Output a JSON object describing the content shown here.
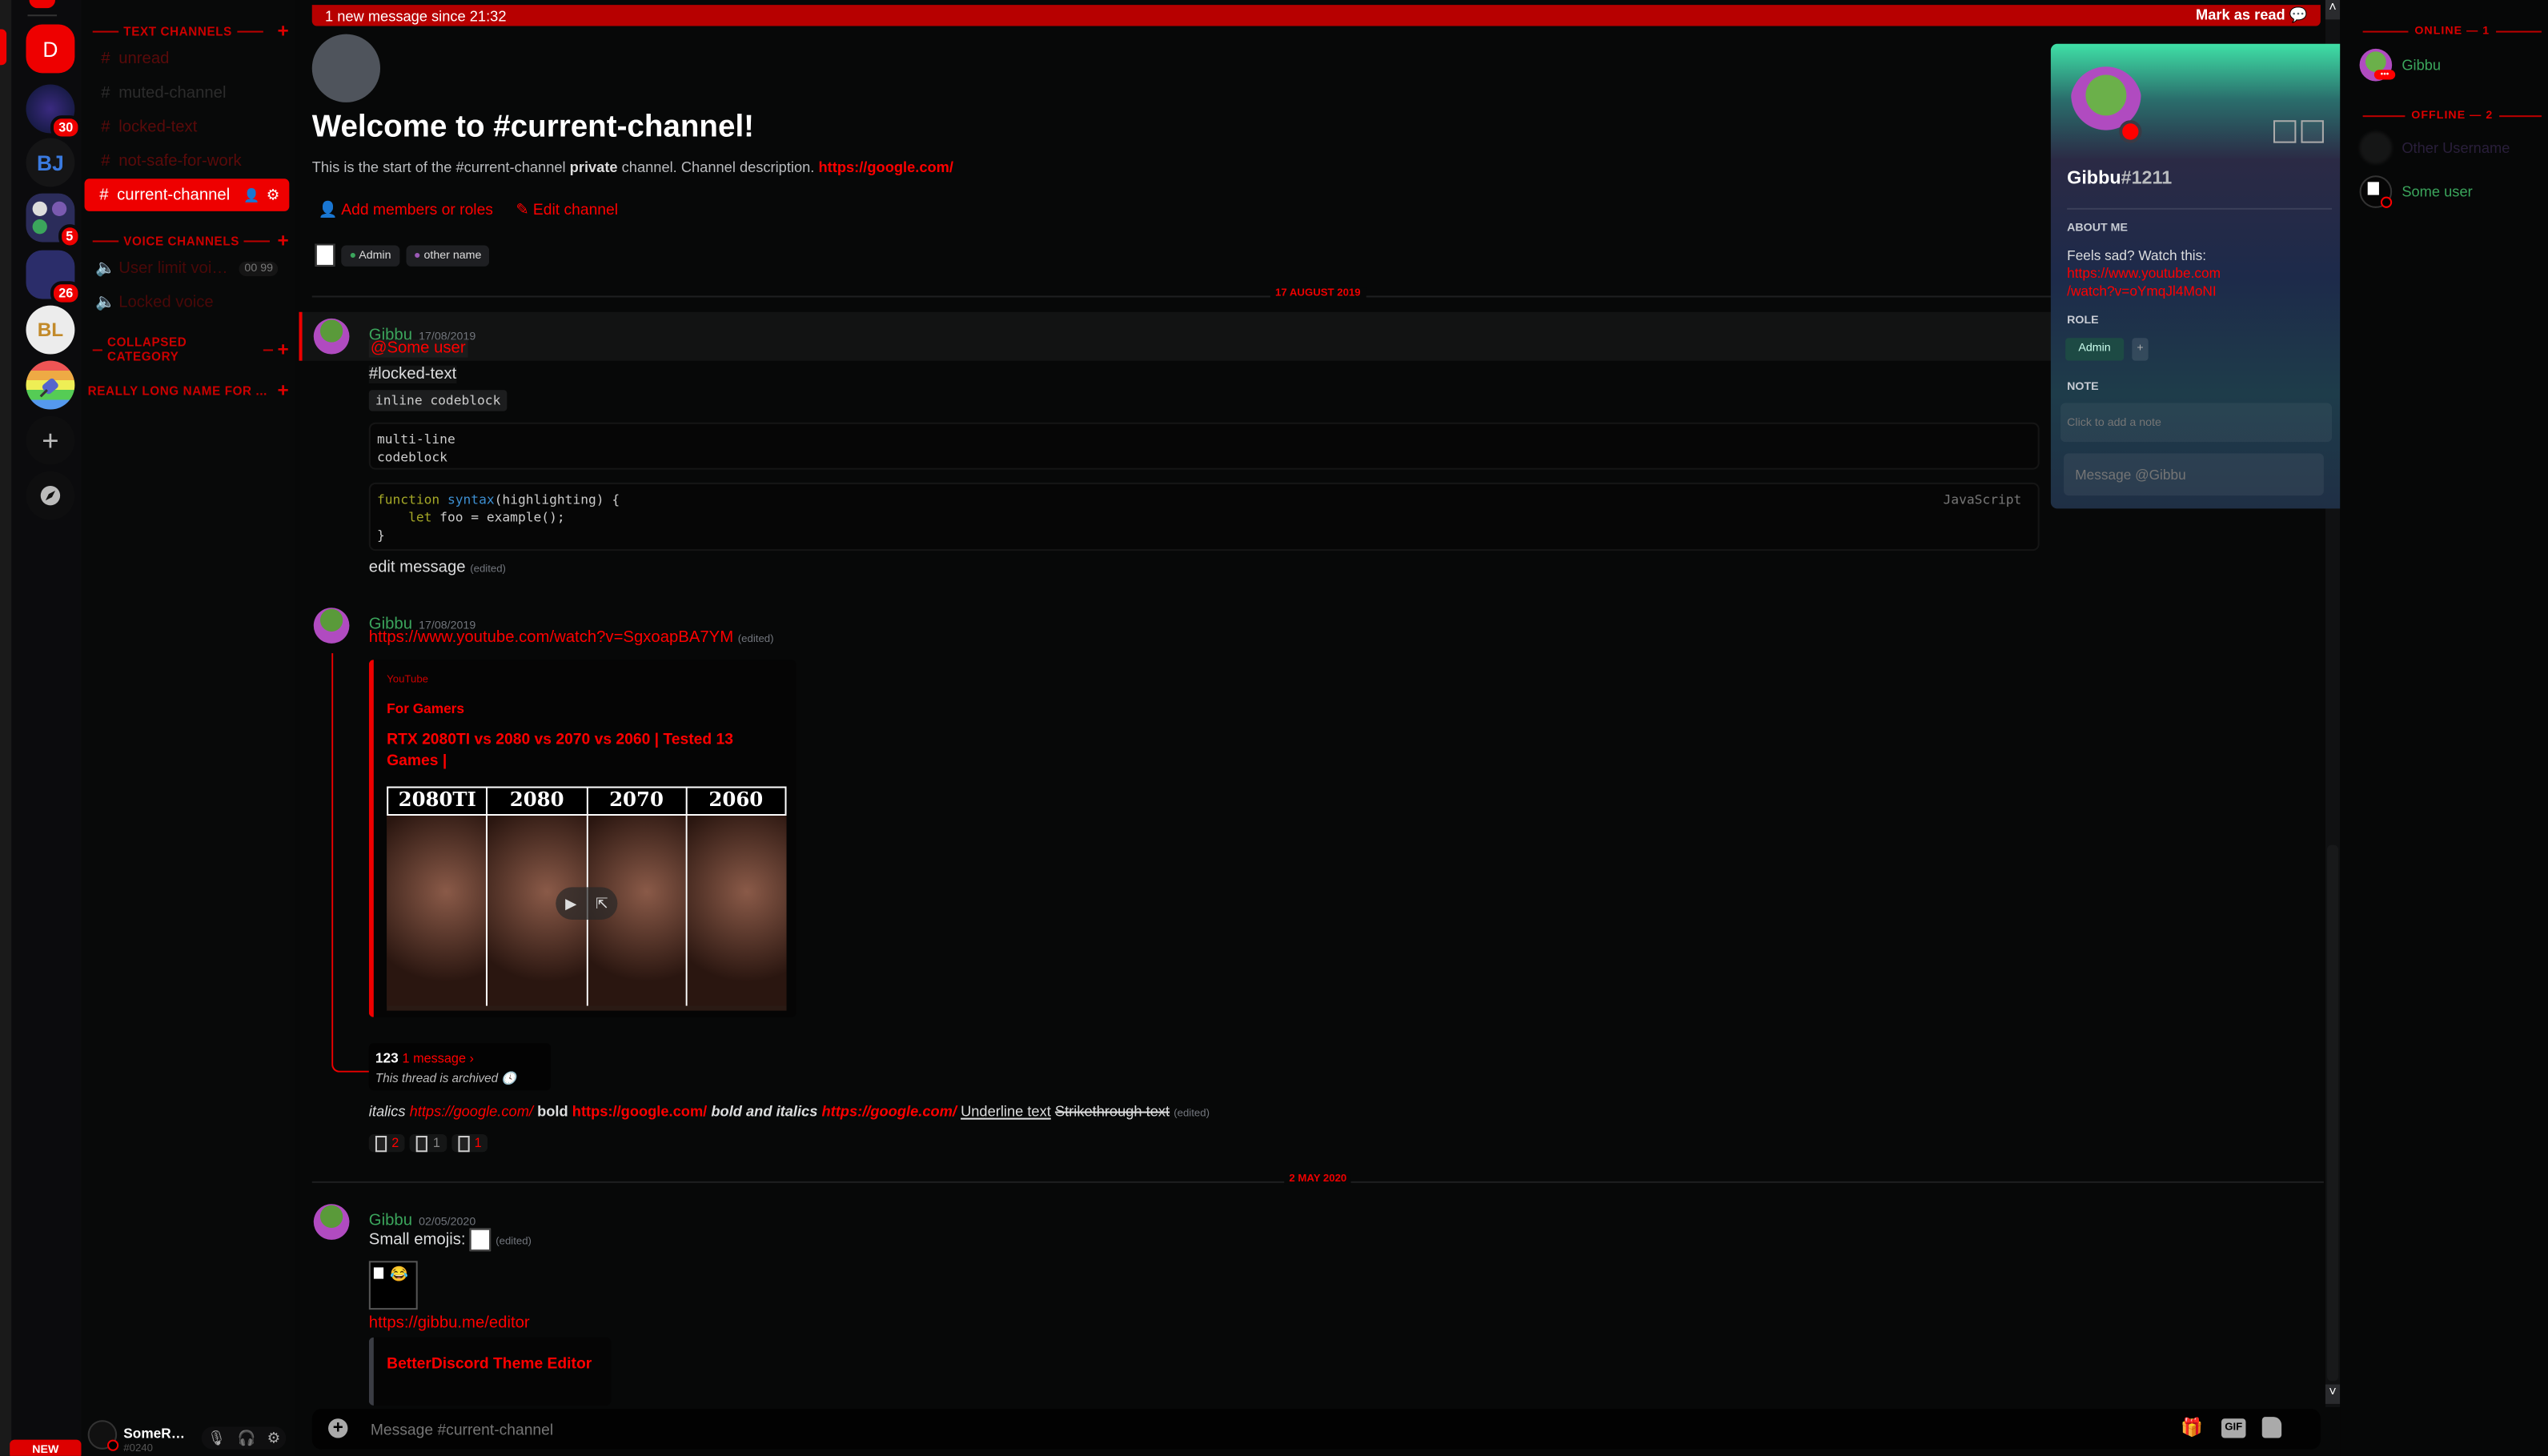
{
  "server_rail": {
    "servers": [
      {
        "name": "D",
        "badge": "",
        "color": "#e00000"
      },
      {
        "name": "Rocket League",
        "badge": "30"
      },
      {
        "name": "BJ",
        "badge": ""
      },
      {
        "name": "Folder",
        "badge": "5"
      },
      {
        "name": "Blank",
        "badge": "26"
      },
      {
        "name": "BL",
        "badge": ""
      },
      {
        "name": "Plug",
        "badge": ""
      }
    ],
    "add_server_icon": "plus-icon",
    "explore_icon": "compass-icon"
  },
  "channels": {
    "categories": [
      {
        "label": "TEXT CHANNELS"
      },
      {
        "label": "VOICE CHANNELS"
      },
      {
        "label": "COLLAPSED CATEGORY"
      },
      {
        "label": "REALLY LONG NAME FOR ..."
      }
    ],
    "text": [
      {
        "label": "unread",
        "state": "locked"
      },
      {
        "label": "muted-channel",
        "state": "muted"
      },
      {
        "label": "locked-text",
        "state": "locked"
      },
      {
        "label": "not-safe-for-work",
        "state": "nsfw"
      },
      {
        "label": "current-channel",
        "state": "active"
      }
    ],
    "voice": [
      {
        "label": "User limit voi…",
        "count": "00",
        "limit": "99"
      },
      {
        "label": "Locked voice"
      }
    ]
  },
  "user_panel": {
    "username": "SomeR…",
    "discriminator": "#0240",
    "new_badge": "NEW"
  },
  "main": {
    "new_messages_bar": "1 new message since 21:32",
    "mark_as_read": "Mark as read",
    "welcome_title": "Welcome to #current-channel!",
    "welcome_desc_pre": "This is the start of the #current-channel ",
    "welcome_desc_bold": "private",
    "welcome_desc_post": " channel. Channel description. ",
    "welcome_link": "https://google.com/",
    "add_members": "Add members or roles",
    "edit_channel": "Edit channel",
    "roles": [
      {
        "label": "Admin",
        "color": "#3ba55c"
      },
      {
        "label": "other name",
        "color": "#9b59b6"
      }
    ],
    "date_dividers": [
      "17 AUGUST 2019",
      "2 MAY 2020"
    ],
    "messages": [
      {
        "author": "Gibbu",
        "timestamp": "17/08/2019",
        "mention": "@Some user",
        "channel_mention": "#locked-text",
        "inline_code": "inline codeblock",
        "multiline_code": [
          "multi-line",
          "codeblock"
        ],
        "code_kw": "function",
        "code_fn": "syntax",
        "code_rest": "(highlighting) {",
        "code_l2_kw": "let",
        "code_l2_rest": " foo = example();",
        "code_l3": "}",
        "code_lang": "JavaScript",
        "edit_text": "edit message",
        "edited": "(edited)"
      },
      {
        "author": "Gibbu",
        "timestamp": "17/08/2019",
        "link": "https://www.youtube.com/watch?v=SgxoapBA7YM",
        "edited": "(edited)",
        "embed_provider": "YouTube",
        "embed_author": "For Gamers",
        "embed_title": "RTX 2080TI vs 2080 vs 2070 vs 2060 | Tested 13 Games |",
        "thumb_labels": [
          "2080TI",
          "2080",
          "2070",
          "2060"
        ],
        "thread_name": "123",
        "thread_count": "1 message ›",
        "thread_status": "This thread is archived",
        "fmt_italics": "italics",
        "fmt_link": "https://google.com/",
        "fmt_bold": "bold",
        "fmt_bold_italics": "bold and italics",
        "fmt_underline": "Underline text",
        "fmt_strike": "Strikethrough text",
        "reactions": [
          {
            "count": "2",
            "active": true
          },
          {
            "count": "1",
            "active": false
          },
          {
            "count": "1",
            "active": true
          }
        ]
      },
      {
        "author": "Gibbu",
        "timestamp": "02/05/2020",
        "text": "Small emojis:",
        "edited": "(edited)",
        "link": "https://gibbu.me/editor",
        "embed_title": "BetterDiscord Theme Editor"
      }
    ],
    "composer_placeholder": "Message #current-channel"
  },
  "popout": {
    "username": "Gibbu",
    "discriminator": "#1211",
    "about_label": "ABOUT ME",
    "about_text": "Feels sad? Watch this:",
    "about_link1": "https://www.youtube.com",
    "about_link2": "/watch?v=oYmqJl4MoNI",
    "role_label": "ROLE",
    "role": "Admin",
    "role_add": "+",
    "note_label": "NOTE",
    "note_placeholder": "Click to add a note",
    "message_placeholder": "Message @Gibbu"
  },
  "members": {
    "online_label": "ONLINE — 1",
    "offline_label": "OFFLINE — 2",
    "online": [
      {
        "name": "Gibbu",
        "color": "#3ba55c"
      }
    ],
    "offline": [
      {
        "name": "Other Username",
        "color": "#2e2340"
      },
      {
        "name": "Some user",
        "color": "#3ba55c"
      }
    ]
  }
}
